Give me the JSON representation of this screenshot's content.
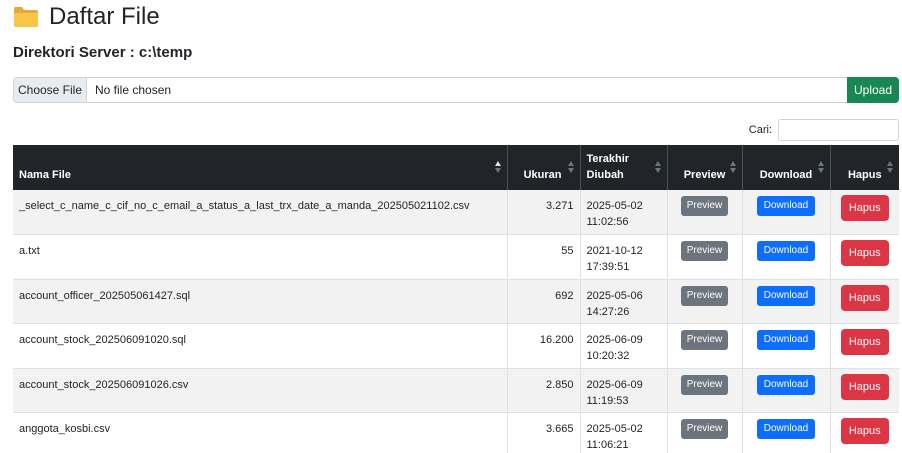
{
  "page": {
    "title": "Daftar File",
    "icon": "folder-icon"
  },
  "directory": {
    "label": "Direktori Server : c:\\temp"
  },
  "upload": {
    "choose_label": "Choose File",
    "status": "No file chosen",
    "button_label": "Upload"
  },
  "search": {
    "label": "Cari:",
    "value": ""
  },
  "colors": {
    "header_bg": "#212529",
    "upload": "#198754",
    "preview": "#6c757d",
    "download": "#0d6efd",
    "hapus": "#dc3545"
  },
  "table": {
    "headers": {
      "name": "Nama File",
      "size": "Ukuran",
      "modified": "Terakhir Diubah",
      "preview": "Preview",
      "download": "Download",
      "hapus": "Hapus"
    },
    "rows": [
      {
        "name": "_select_c_name_c_cif_no_c_email_a_status_a_last_trx_date_a_manda_202505021102.csv",
        "size": "3.271",
        "date": "2025-05-02",
        "time": "11:02:56",
        "preview": "Preview",
        "download": "Download",
        "hapus": "Hapus"
      },
      {
        "name": "a.txt",
        "size": "55",
        "date": "2021-10-12",
        "time": "17:39:51",
        "preview": "Preview",
        "download": "Download",
        "hapus": "Hapus"
      },
      {
        "name": "account_officer_202505061427.sql",
        "size": "692",
        "date": "2025-05-06",
        "time": "14:27:26",
        "preview": "Preview",
        "download": "Download",
        "hapus": "Hapus"
      },
      {
        "name": "account_stock_202506091020.sql",
        "size": "16.200",
        "date": "2025-06-09",
        "time": "10:20:32",
        "preview": "Preview",
        "download": "Download",
        "hapus": "Hapus"
      },
      {
        "name": "account_stock_202506091026.csv",
        "size": "2.850",
        "date": "2025-06-09",
        "time": "11:19:53",
        "preview": "Preview",
        "download": "Download",
        "hapus": "Hapus"
      },
      {
        "name": "anggota_kosbi.csv",
        "size": "3.665",
        "date": "2025-05-02",
        "time": "11:06:21",
        "preview": "Preview",
        "download": "Download",
        "hapus": "Hapus"
      }
    ]
  }
}
